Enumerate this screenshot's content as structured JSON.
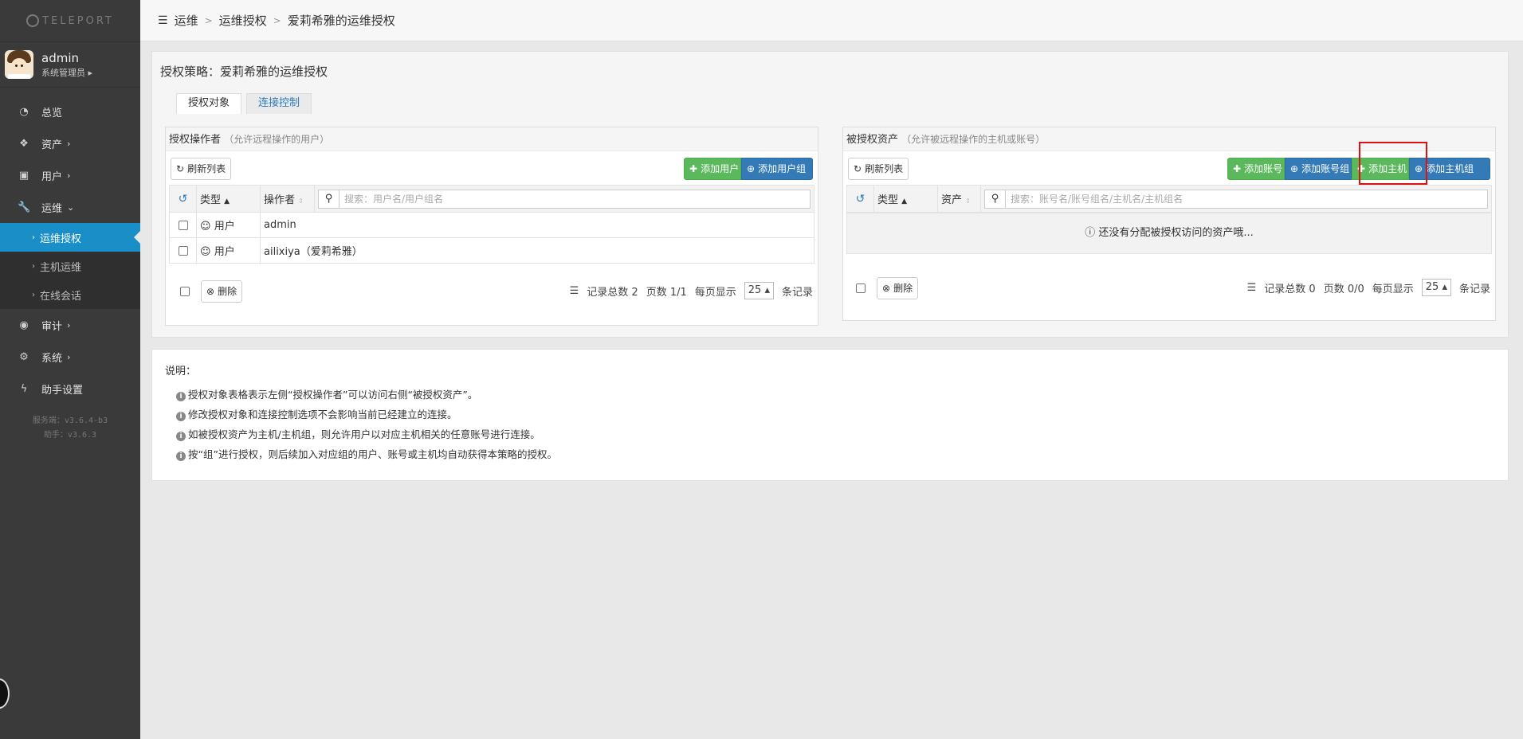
{
  "sidebar": {
    "logo": "TELEPORT",
    "user": {
      "name": "admin",
      "role": "系统管理员"
    },
    "items": [
      {
        "label": "总览"
      },
      {
        "label": "资产"
      },
      {
        "label": "用户"
      },
      {
        "label": "运维"
      },
      {
        "label": "运维授权"
      },
      {
        "label": "主机运维"
      },
      {
        "label": "在线会话"
      },
      {
        "label": "审计"
      },
      {
        "label": "系统"
      },
      {
        "label": "助手设置"
      }
    ],
    "version_server": "服务端：v3.6.4-b3",
    "version_assist": "助手：v3.6.3"
  },
  "breadcrumb": [
    "运维",
    "运维授权",
    "爱莉希雅的运维授权"
  ],
  "policy": {
    "title": "授权策略：爱莉希雅的运维授权"
  },
  "tabs": [
    "授权对象",
    "连接控制"
  ],
  "left": {
    "title": "授权操作者",
    "hint": "（允许远程操作的用户）",
    "refresh": "刷新列表",
    "add_user": "添加用户",
    "add_group": "添加用户组",
    "col_type": "类型",
    "col_op": "操作者",
    "search_ph": "搜索：用户名/用户组名",
    "rows": [
      {
        "type": "用户",
        "name": "admin"
      },
      {
        "type": "用户",
        "name": "ailixiya（爱莉希雅）"
      }
    ],
    "delete": "删除",
    "total": "记录总数 2",
    "pages": "页数 1/1",
    "per_page": "每页显示",
    "size": "25",
    "unit": "条记录"
  },
  "right": {
    "title": "被授权资产",
    "hint": "（允许被远程操作的主机或账号）",
    "refresh": "刷新列表",
    "add_account": "添加账号",
    "add_account_group": "添加账号组",
    "add_host": "添加主机",
    "add_host_group": "添加主机组",
    "col_type": "类型",
    "col_asset": "资产",
    "search_ph": "搜索：账号名/账号组名/主机名/主机组名",
    "empty": "还没有分配被授权访问的资产哦...",
    "delete": "删除",
    "total": "记录总数 0",
    "pages": "页数 0/0",
    "per_page": "每页显示",
    "size": "25",
    "unit": "条记录"
  },
  "notes": {
    "title": "说明：",
    "items": [
      "授权对象表格表示左侧“授权操作者”可以访问右侧“被授权资产”。",
      "修改授权对象和连接控制选项不会影响当前已经建立的连接。",
      "如被授权资产为主机/主机组，则允许用户以对应主机相关的任意账号进行连接。",
      "按“组”进行授权，则后续加入对应组的用户、账号或主机均自动获得本策略的授权。"
    ]
  },
  "colors": {
    "accent": "#1a8fc7",
    "green": "#5cb85c",
    "blue": "#337ab7",
    "highlight": "#e01010"
  }
}
